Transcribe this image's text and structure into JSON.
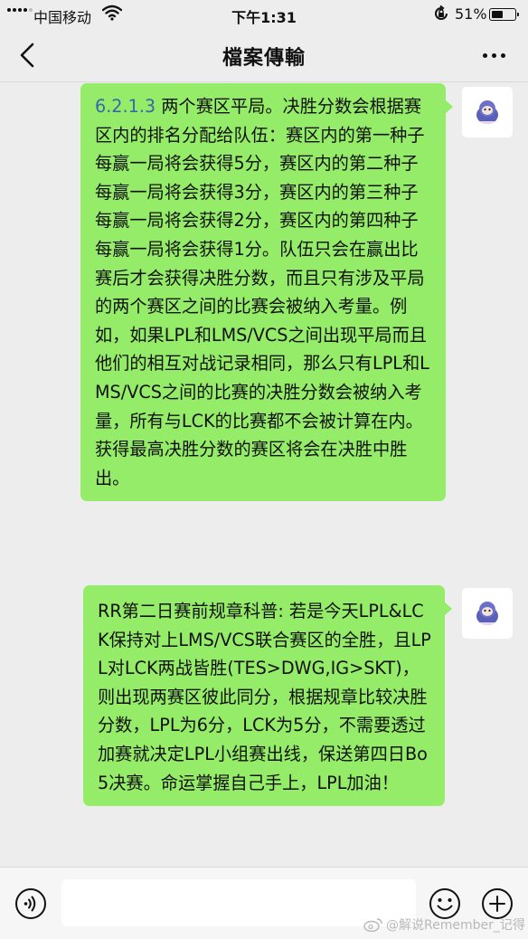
{
  "status_bar": {
    "carrier": "中国移动",
    "time": "下午1:31",
    "battery_percent": "51%",
    "battery_level": 0.51,
    "signal_bars": 4
  },
  "nav": {
    "title": "檔案傳輸"
  },
  "messages": [
    {
      "rule_ref": "6.2.1.3",
      "text": " 两个赛区平局。决胜分数会根据赛区内的排名分配给队伍：赛区内的第一种子每赢一局将会获得5分，赛区内的第二种子每赢一局将会获得3分，赛区内的第三种子每赢一局将会获得2分，赛区内的第四种子每赢一局将会获得1分。队伍只会在赢出比赛后才会获得决胜分数，而且只有涉及平局的两个赛区之间的比赛会被纳入考量。例如，如果LPL和LMS/VCS之间出现平局而且他们的相互对战记录相同，那么只有LPL和LMS/VCS之间的比赛的决胜分数会被纳入考量，所有与LCK的比赛都不会被计算在内。获得最高决胜分数的赛区将会在决胜中胜出。"
    },
    {
      "text": "RR第二日赛前规章科普: 若是今天LPL&LCK保持对上LMS/VCS联合赛区的全胜，且LPL对LCK两战皆胜(TES>DWG,IG>SKT)，则出现两赛区彼此同分，根据规章比较决胜分数，LPL为6分，LCK为5分，不需要透过加赛就决定LPL小组赛出线，保送第四日Bo5决赛。命运掌握自己手上，LPL加油！"
    }
  ],
  "input": {
    "value": ""
  },
  "watermark": {
    "text": "@解说Remember_记得"
  },
  "colors": {
    "bubble": "#95ec69",
    "link": "#3a67a9",
    "background": "#ededed"
  },
  "icons": {
    "back": "chevron-left-icon",
    "more": "more-dots-icon",
    "voice": "voice-icon",
    "emoji": "emoji-icon",
    "plus": "plus-icon"
  }
}
